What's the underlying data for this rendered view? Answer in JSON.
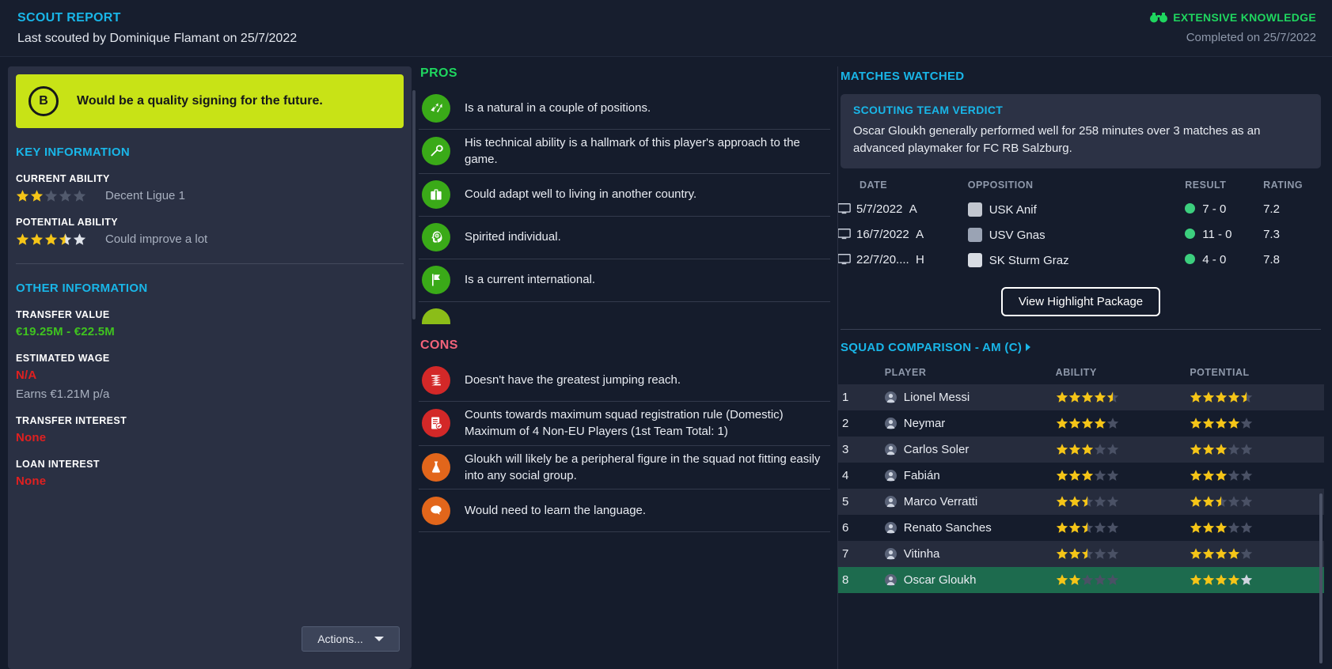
{
  "header": {
    "title": "SCOUT REPORT",
    "subtitle": "Last scouted by Dominique Flamant on 25/7/2022",
    "knowledge": "EXTENSIVE KNOWLEDGE",
    "knowledge_icon": "binoculars-icon",
    "completed": "Completed on 25/7/2022",
    "accent_blue": "#19b6e8",
    "accent_green": "#1fd65f"
  },
  "left": {
    "verdict_grade": "B",
    "verdict_text": "Would be a quality signing for the future.",
    "verdict_bg": "#c8e316",
    "key_information_head": "KEY INFORMATION",
    "current_ability": {
      "label": "CURRENT ABILITY",
      "stars": 2,
      "max_stars": 5,
      "note": "Decent Ligue 1"
    },
    "potential_ability": {
      "label": "POTENTIAL ABILITY",
      "stars": 3.5,
      "max_stars": 5,
      "note": "Could improve a lot"
    },
    "other_information_head": "OTHER INFORMATION",
    "transfer_value": {
      "label": "TRANSFER VALUE",
      "value": "€19.25M - €22.5M",
      "color": "#3fc31f"
    },
    "estimated_wage": {
      "label": "ESTIMATED WAGE",
      "value": "N/A",
      "color": "#e02020",
      "note": "Earns €1.21M p/a"
    },
    "transfer_interest": {
      "label": "TRANSFER INTEREST",
      "value": "None",
      "color": "#e02020"
    },
    "loan_interest": {
      "label": "LOAN INTEREST",
      "value": "None",
      "color": "#e02020"
    },
    "actions_label": "Actions..."
  },
  "pros": {
    "head": "PROS",
    "items": [
      {
        "icon": "arrows-positions-icon",
        "color": "#3aaa18",
        "text": "Is a natural in a couple of positions."
      },
      {
        "icon": "wrench-icon",
        "color": "#3aaa18",
        "text": "His technical ability is a hallmark of this player's approach to the game."
      },
      {
        "icon": "suitcase-icon",
        "color": "#3aaa18",
        "text": "Could adapt well to living in another country."
      },
      {
        "icon": "head-mind-icon",
        "color": "#3aaa18",
        "text": "Spirited individual."
      },
      {
        "icon": "flag-icon",
        "color": "#3aaa18",
        "text": "Is a current international."
      },
      {
        "icon": "partial-icon",
        "color": "#8bbd18",
        "text": ""
      }
    ]
  },
  "cons": {
    "head": "CONS",
    "items": [
      {
        "icon": "jump-icon",
        "color": "#d32828",
        "text": "Doesn't have the greatest jumping reach."
      },
      {
        "icon": "document-check-icon",
        "color": "#d32828",
        "text": "Counts towards maximum squad registration rule (Domestic) Maximum of 4 Non-EU Players (1st Team Total: 1)"
      },
      {
        "icon": "flask-icon",
        "color": "#e2661b",
        "text": "Gloukh will likely be a peripheral figure in the squad not fitting easily into any social group."
      },
      {
        "icon": "speech-bubble-icon",
        "color": "#e2661b",
        "text": "Would need to learn the language."
      }
    ]
  },
  "right": {
    "matches_head": "MATCHES WATCHED",
    "verdict_head": "SCOUTING TEAM VERDICT",
    "verdict_text": "Oscar Gloukh generally performed well for 258 minutes over 3 matches as an advanced playmaker for FC RB Salzburg.",
    "matches_columns": [
      "DATE",
      "OPPOSITION",
      "RESULT",
      "RATING"
    ],
    "matches": [
      {
        "icon": "monitor-icon",
        "date": "5/7/2022",
        "venue": "A",
        "badge": "usk-anif-badge",
        "badge_color": "#c2c7d0",
        "opposition": "USK Anif",
        "result": "7 - 0",
        "result_color": "#3ccf7e",
        "rating": "7.2"
      },
      {
        "icon": "monitor-icon",
        "date": "16/7/2022",
        "venue": "A",
        "badge": "usv-gnas-badge",
        "badge_color": "#9aa3b4",
        "opposition": "USV Gnas",
        "result": "11 - 0",
        "result_color": "#3ccf7e",
        "rating": "7.3"
      },
      {
        "icon": "monitor-icon",
        "date": "22/7/20....",
        "venue": "H",
        "badge": "sk-sturm-graz-badge",
        "badge_color": "#d8dce3",
        "opposition": "SK Sturm Graz",
        "result": "4 - 0",
        "result_color": "#3ccf7e",
        "rating": "7.8"
      }
    ],
    "highlight_button": "View Highlight Package",
    "squad_head": "SQUAD COMPARISON - AM (C)",
    "squad_columns": [
      "",
      "PLAYER",
      "ABILITY",
      "POTENTIAL"
    ],
    "squad": [
      {
        "rank": "1",
        "player": "Lionel Messi",
        "ability": 4.5,
        "potential": 4.5,
        "selected": false
      },
      {
        "rank": "2",
        "player": "Neymar",
        "ability": 4,
        "potential": 4,
        "selected": false
      },
      {
        "rank": "3",
        "player": "Carlos Soler",
        "ability": 3,
        "potential": 3,
        "selected": false
      },
      {
        "rank": "4",
        "player": "Fabián",
        "ability": 3,
        "potential": 3,
        "selected": false
      },
      {
        "rank": "5",
        "player": "Marco Verratti",
        "ability": 2.5,
        "potential": 2.5,
        "selected": false
      },
      {
        "rank": "6",
        "player": "Renato Sanches",
        "ability": 2.5,
        "potential": 3,
        "selected": false
      },
      {
        "rank": "7",
        "player": "Vitinha",
        "ability": 2.5,
        "potential": 4,
        "selected": false
      },
      {
        "rank": "8",
        "player": "Oscar Gloukh",
        "ability": 2,
        "potential": 4,
        "selected": true
      }
    ],
    "star_full_color": "#f5c518",
    "star_empty_color": "#4a5165",
    "selected_row_color": "#1d6b4e"
  }
}
